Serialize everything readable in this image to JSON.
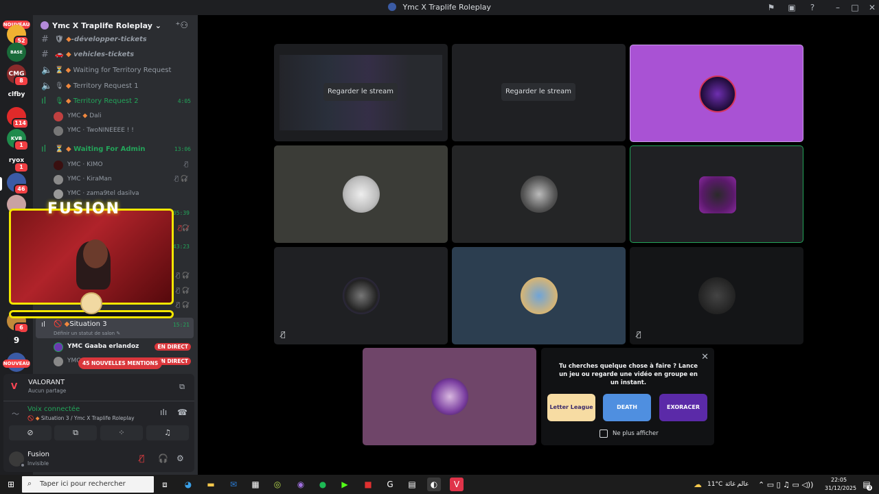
{
  "window": {
    "title": "Ymc X Traplife Roleplay"
  },
  "rail": {
    "nouveau_top": "NOUVEAU",
    "nouveau_bottom": "NOUVEAU",
    "servers": [
      {
        "label": "",
        "badge": "52"
      },
      {
        "label": "BASE",
        "badge": ""
      },
      {
        "label": "CMG",
        "badge": "8"
      },
      {
        "label": "clfby",
        "badge": ""
      },
      {
        "label": "",
        "badge": "114"
      },
      {
        "label": "KVB",
        "badge": "1"
      },
      {
        "label": "ryox",
        "badge": "1"
      },
      {
        "label": "",
        "badge": "46"
      },
      {
        "label": "",
        "badge": "6"
      },
      {
        "label": "9",
        "badge": ""
      }
    ]
  },
  "server": {
    "name": "Ymc X Traplife Roleplay"
  },
  "channels": [
    {
      "label": "-développer-tickets",
      "time": ""
    },
    {
      "label": "vehicles-tickets",
      "time": ""
    },
    {
      "label": "Waiting for Territory Request",
      "time": ""
    },
    {
      "label": "Territory Request 1",
      "time": ""
    },
    {
      "label": "Territory Request 2",
      "time": "4:05"
    },
    {
      "label": "Waiting For Admin",
      "time": "13:06"
    },
    {
      "label": "Situation 3",
      "time": "15:21",
      "status": "Définir un statut de salon"
    }
  ],
  "hidden_times": [
    "05:39",
    "43:23"
  ],
  "users": [
    {
      "prefix": "YMC",
      "name": "Dali"
    },
    {
      "prefix": "YMC",
      "name": "TwoNINEEEE ! !"
    },
    {
      "prefix": "YMC",
      "name": "KIMO"
    },
    {
      "prefix": "YMC",
      "name": "KiraMan"
    },
    {
      "prefix": "YMC",
      "name": "zama9tel dasilva"
    },
    {
      "prefix": "YMC",
      "name": "Gaaba erlandoz",
      "live": "EN DIRECT"
    },
    {
      "prefix": "YMC",
      "name": "",
      "live": "EN DIRECT"
    }
  ],
  "mentions": "45 NOUVELLES MENTIONS",
  "webcam": {
    "brand": "FUSION"
  },
  "activity": {
    "title": "VALORANT",
    "sub": "Aucun partage"
  },
  "voice": {
    "title": "Voix connectée",
    "sub": "Situation 3 / Ymc X Traplife Roleplay"
  },
  "user": {
    "name": "Fusion",
    "status": "Invisible"
  },
  "stream": {
    "watch_label": "Regarder le stream"
  },
  "overlay": {
    "message": "Tu cherches quelque chose à faire ? Lance un jeu ou regarde une vidéo en groupe en un instant.",
    "games": [
      "Letter League",
      "DEATH",
      "EXORACER"
    ],
    "checkbox": "Ne plus afficher"
  },
  "taskbar": {
    "search_placeholder": "Taper ici pour rechercher",
    "weather": "11°C",
    "arabic": "عالم غائة",
    "time": "22:05",
    "date": "31/12/2025",
    "notif_count": "3"
  },
  "colors": {
    "accent_live": "#23a55a",
    "danger": "#da373c",
    "webcam_frame": "#f3e600"
  }
}
